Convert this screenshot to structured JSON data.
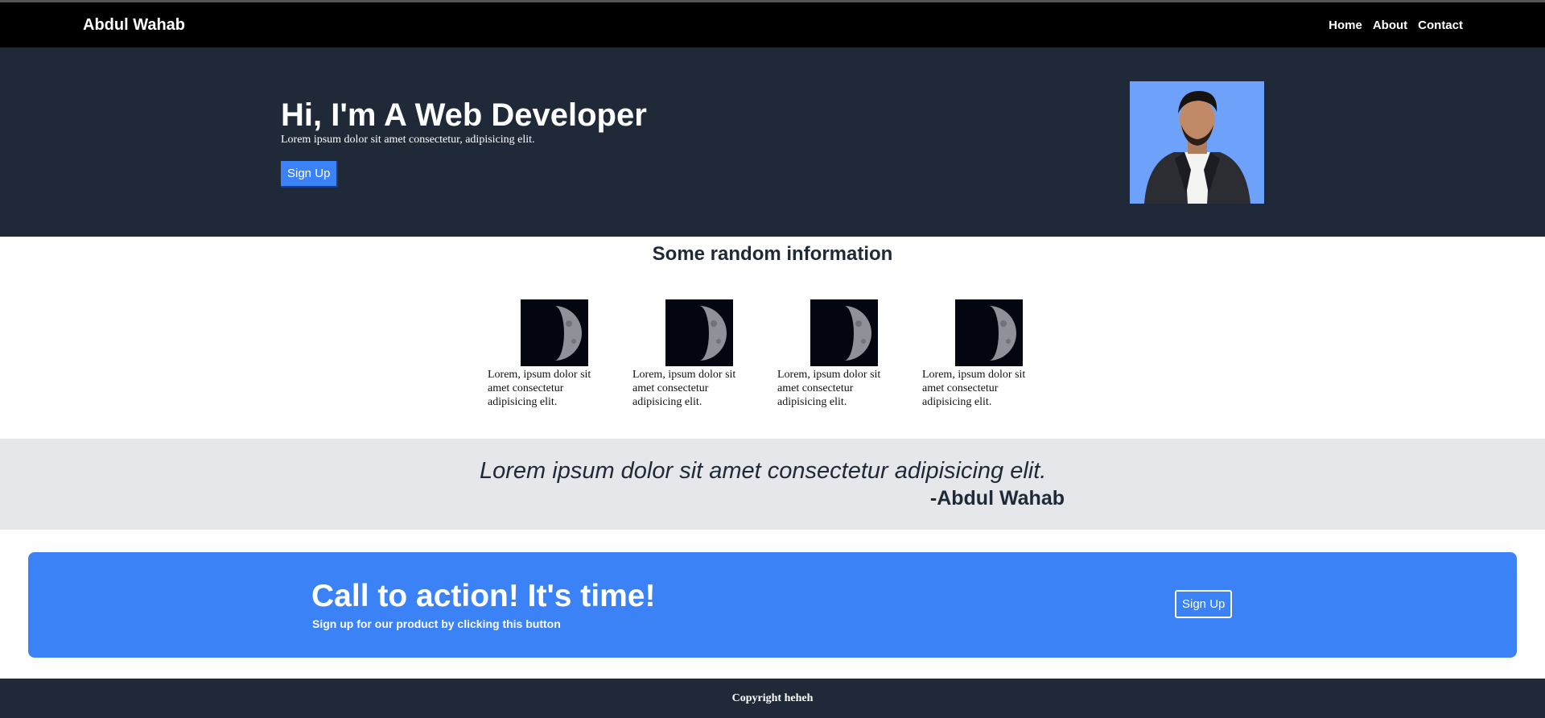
{
  "nav": {
    "brand": "Abdul Wahab",
    "links": [
      "Home",
      "About",
      "Contact"
    ]
  },
  "hero": {
    "title": "Hi, I'm A Web Developer",
    "subtitle": "Lorem ipsum dolor sit amet consectetur, adipisicing elit.",
    "button": "Sign Up"
  },
  "info": {
    "title": "Some random information",
    "cards": [
      {
        "text": "Lorem, ipsum dolor sit amet consectetur adipisicing elit."
      },
      {
        "text": "Lorem, ipsum dolor sit amet consectetur adipisicing elit."
      },
      {
        "text": "Lorem, ipsum dolor sit amet consectetur adipisicing elit."
      },
      {
        "text": "Lorem, ipsum dolor sit amet consectetur adipisicing elit."
      }
    ]
  },
  "quote": {
    "text": "Lorem ipsum dolor sit amet consectetur adipisicing elit.",
    "author": "-Abdul Wahab"
  },
  "cta": {
    "title": "Call to action! It's time!",
    "subtitle": "Sign up for our product by clicking this button",
    "button": "Sign Up"
  },
  "footer": {
    "text": "Copyright heheh"
  },
  "colors": {
    "nav_bg": "#000000",
    "hero_bg": "#1f2937",
    "accent": "#3b82f6",
    "quote_bg": "#e5e7eb",
    "avatar_bg": "#6ea2fa"
  },
  "icons": {
    "avatar": "profile-photo",
    "card_image": "moon-image"
  }
}
